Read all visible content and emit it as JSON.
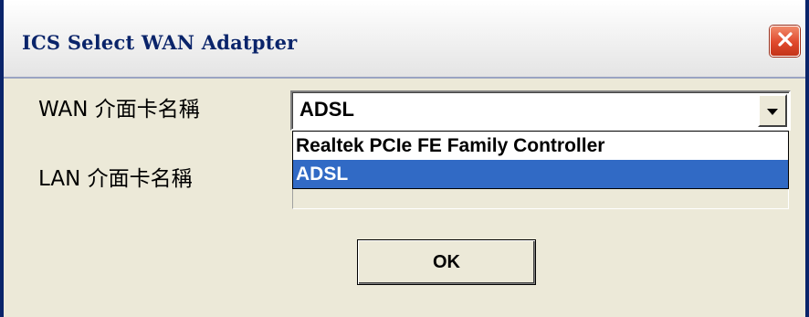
{
  "window": {
    "title": "ICS Select WAN Adatpter"
  },
  "titlebar": {
    "close_icon": "close-x-icon"
  },
  "form": {
    "wan_label": "WAN 介面卡名稱",
    "lan_label": "LAN 介面卡名稱",
    "wan_selected": "ADSL",
    "dropdown_arrow_icon": "chevron-down-icon",
    "dropdown_options": [
      "Realtek PCIe FE Family Controller",
      "ADSL"
    ],
    "highlighted_option": "ADSL"
  },
  "buttons": {
    "ok_label": "OK"
  },
  "colors": {
    "title_text": "#0a246a",
    "close_button": "#e0492c",
    "selection_highlight": "#316ac5",
    "dialog_bg": "#ece9d8"
  }
}
